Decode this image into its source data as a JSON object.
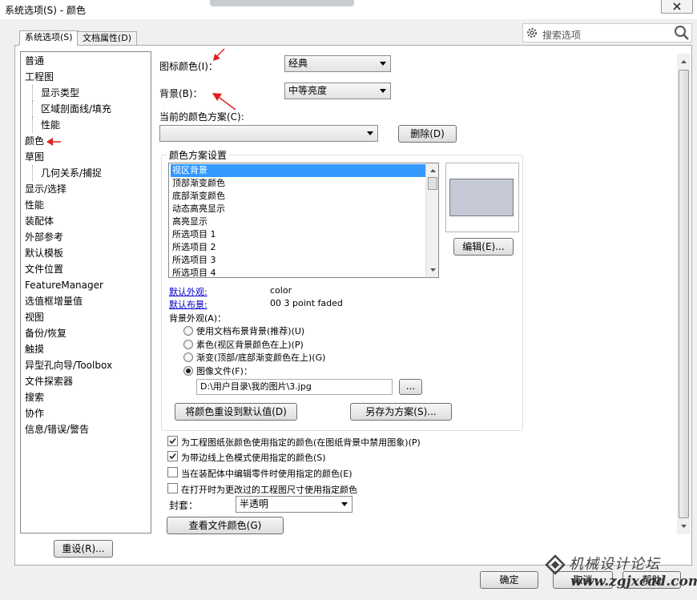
{
  "window": {
    "title": "系统选项(S) - 颜色"
  },
  "tabs": [
    {
      "label": "系统选项(S)"
    },
    {
      "label": "文档属性(D)"
    }
  ],
  "search": {
    "placeholder": "搜索选项"
  },
  "tree": {
    "items": [
      {
        "label": "普通"
      },
      {
        "label": "工程图"
      },
      {
        "label": "显示类型"
      },
      {
        "label": "区域剖面线/填充"
      },
      {
        "label": "性能"
      },
      {
        "label": "颜色"
      },
      {
        "label": "草图"
      },
      {
        "label": "几何关系/捕捉"
      },
      {
        "label": "显示/选择"
      },
      {
        "label": "性能"
      },
      {
        "label": "装配体"
      },
      {
        "label": "外部参考"
      },
      {
        "label": "默认模板"
      },
      {
        "label": "文件位置"
      },
      {
        "label": "FeatureManager"
      },
      {
        "label": "选值框增量值"
      },
      {
        "label": "视图"
      },
      {
        "label": "备份/恢复"
      },
      {
        "label": "触摸"
      },
      {
        "label": "异型孔向导/Toolbox"
      },
      {
        "label": "文件探索器"
      },
      {
        "label": "搜索"
      },
      {
        "label": "协作"
      },
      {
        "label": "信息/错误/警告"
      }
    ]
  },
  "color_page": {
    "icon_color_label": "图标颜色(I)：",
    "icon_color_value": "经典",
    "background_label": "背景(B)：",
    "background_value": "中等亮度",
    "scheme_label": "当前的颜色方案(C):",
    "scheme_value": "",
    "delete_button": "删除(D)",
    "group_title": "颜色方案设置",
    "scheme_items": [
      {
        "label": "视区背景"
      },
      {
        "label": "顶部渐变颜色"
      },
      {
        "label": "底部渐变颜色"
      },
      {
        "label": "动态高亮显示"
      },
      {
        "label": "高亮显示"
      },
      {
        "label": "所选项目 1"
      },
      {
        "label": "所选项目 2"
      },
      {
        "label": "所选项目 3"
      },
      {
        "label": "所选项目 4"
      }
    ],
    "swatch_color": "#c6c9d6",
    "edit_button": "编辑(E)...",
    "default_appearance_label": "默认外观:",
    "default_appearance_value": "color",
    "default_scene_label": "默认布景:",
    "default_scene_value": "00 3 point faded",
    "bg_appearance_label": "背景外观(A)：",
    "radios": [
      {
        "label": "使用文档布景背景(推荐)(U)",
        "checked": false
      },
      {
        "label": "素色(视区背景颜色在上)(P)",
        "checked": false
      },
      {
        "label": "渐变(顶部/底部渐变颜色在上)(G)",
        "checked": false
      },
      {
        "label": "图像文件(F)：",
        "checked": true
      }
    ],
    "image_path": "D:\\用户目录\\我的图片\\3.jpg",
    "browse_button": "...",
    "reset_colors_button": "将颜色重设到默认值(D)",
    "save_scheme_button": "另存为方案(S)...",
    "checkboxes": [
      {
        "label": "为工程图纸张颜色使用指定的颜色(在图纸背景中禁用图象)(P)",
        "checked": true
      },
      {
        "label": "为带边线上色模式使用指定的颜色(S)",
        "checked": true
      },
      {
        "label": "当在装配体中编辑零件时使用指定的颜色(E)",
        "checked": false
      },
      {
        "label": "在打开时为更改过的工程图尺寸使用指定颜色",
        "checked": false
      }
    ],
    "envelope_label": "封套：",
    "envelope_value": "半透明",
    "view_doc_colors_button": "查看文件颜色(G)"
  },
  "footer": {
    "reset_button": "重设(R)...",
    "ok_button": "确定",
    "cancel_button": "取消",
    "help_button": "帮助"
  },
  "watermark": {
    "text_cn": "机械设计论坛",
    "text_url": "www.zgjxcad.com"
  },
  "colors": {
    "selection": "#3399ff",
    "link": "#0000cc",
    "arrow": "#e02020"
  }
}
